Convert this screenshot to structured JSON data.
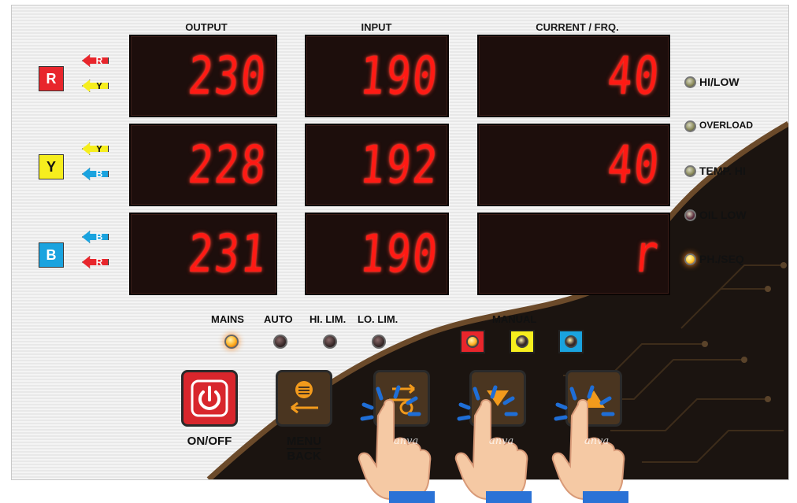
{
  "headers": {
    "output": "OUTPUT",
    "input": "INPUT",
    "current": "CURRENT / FRQ."
  },
  "rows": [
    {
      "phase": "R",
      "color": "#e8262c",
      "ref_top": "R",
      "ref_bottom": "Y",
      "ref_top_color": "#e8262c",
      "ref_bottom_color": "#f6ee1e",
      "output": "230",
      "input": "190",
      "current": "40"
    },
    {
      "phase": "Y",
      "color": "#f6ee1e",
      "ref_top": "Y",
      "ref_bottom": "B",
      "ref_top_color": "#f6ee1e",
      "ref_bottom_color": "#1aa3df",
      "output": "228",
      "input": "192",
      "current": "40"
    },
    {
      "phase": "B",
      "color": "#1aa3df",
      "ref_top": "B",
      "ref_bottom": "R",
      "ref_top_color": "#1aa3df",
      "ref_bottom_color": "#e8262c",
      "output": "231",
      "input": "190",
      "current": "r"
    }
  ],
  "status_indicators": [
    {
      "label": "HI/LOW",
      "lamp_color": "#8a8a5a",
      "on": false
    },
    {
      "label": "OVERLOAD",
      "lamp_color": "#8a8a5a",
      "on": false
    },
    {
      "label": "TEMP. HI",
      "lamp_color": "#8a8a5a",
      "on": false
    },
    {
      "label": "OIL LOW",
      "lamp_color": "#5a2a3a",
      "on": false
    },
    {
      "label": "PH./SEQ",
      "lamp_color": "#ffcc33",
      "on": true
    }
  ],
  "modes": [
    {
      "label": "MAINS",
      "lamp_color": "#ffb020",
      "on": true
    },
    {
      "label": "AUTO",
      "lamp_color": "#3a2a2a",
      "on": false
    },
    {
      "label": "HI. LIM.",
      "lamp_color": "#3a2a2a",
      "on": false
    },
    {
      "label": "LO. LIM.",
      "lamp_color": "#3a2a2a",
      "on": false
    }
  ],
  "manual": {
    "label": "MANUAL",
    "boxes": [
      {
        "phase": "R",
        "box_color": "#e8262c",
        "lamp_color": "#ffb020"
      },
      {
        "phase": "Y",
        "box_color": "#f6ee1e",
        "lamp_color": "#3a2a2a"
      },
      {
        "phase": "B",
        "box_color": "#1aa3df",
        "lamp_color": "#3a2a2a"
      }
    ]
  },
  "buttons": [
    {
      "label": "ON/OFF",
      "icon": "power-icon",
      "color": "#e0262c"
    },
    {
      "label_line1": "MENU",
      "label_line2": "BACK",
      "icon": "menu-back-icon",
      "color": "#5a3a1e"
    },
    {
      "label": "ENT",
      "icon": "enter-icon",
      "color": "#5a3a1e"
    },
    {
      "label": "D",
      "icon": "down-icon",
      "color": "#5a3a1e"
    },
    {
      "label": "",
      "icon": "up-icon",
      "color": "#5a3a1e"
    }
  ],
  "watermarks": [
    "anva",
    "anva",
    "anva"
  ]
}
